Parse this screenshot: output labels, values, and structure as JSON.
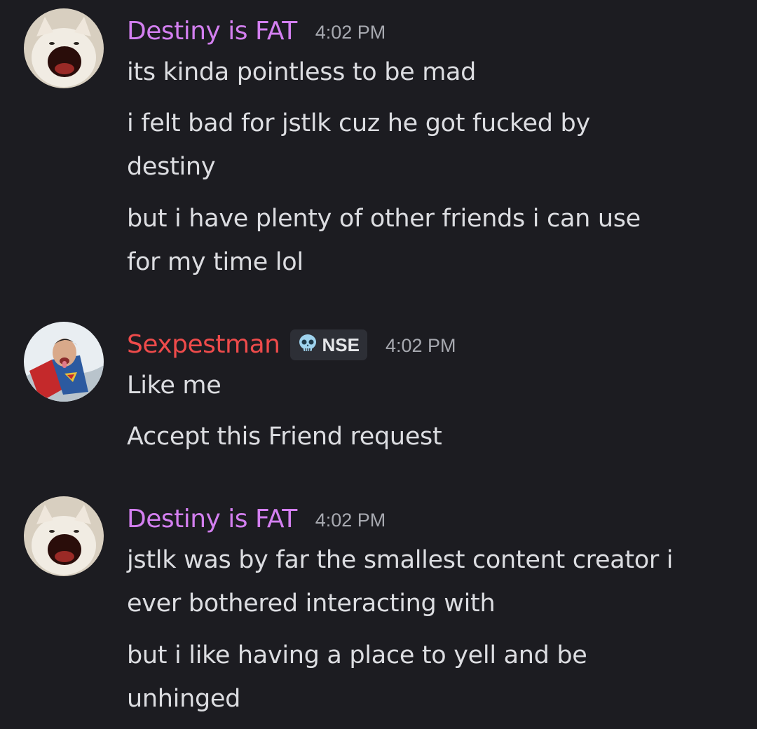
{
  "colors": {
    "background": "#1c1c21",
    "username_purple": "#d37ff0",
    "username_red": "#ee4b4b",
    "message_text": "#dcdde1",
    "timestamp": "#a7a9b0",
    "tag_background": "#2d2f36"
  },
  "messages": [
    {
      "username": "Destiny is FAT",
      "username_color": "#d37ff0",
      "avatar_icon": "screaming-cat-avatar",
      "timestamp": "4:02 PM",
      "lines": [
        "its kinda pointless to be mad",
        "i felt bad for jstlk cuz he got fucked by",
        "destiny",
        "but i have plenty of other friends i can use",
        "for my time lol"
      ]
    },
    {
      "username": "Sexpestman",
      "username_color": "#ee4b4b",
      "avatar_icon": "superman-avatar",
      "tag": {
        "icon": "skull-icon",
        "label": "NSE"
      },
      "timestamp": "4:02 PM",
      "lines": [
        "Like me",
        "Accept this Friend request"
      ]
    },
    {
      "username": "Destiny is FAT",
      "username_color": "#d37ff0",
      "avatar_icon": "screaming-cat-avatar",
      "timestamp": "4:02 PM",
      "lines": [
        "jstlk was by far the smallest content creator i",
        "ever bothered interacting with",
        "but i like having a place to yell and be",
        "unhinged"
      ]
    }
  ]
}
